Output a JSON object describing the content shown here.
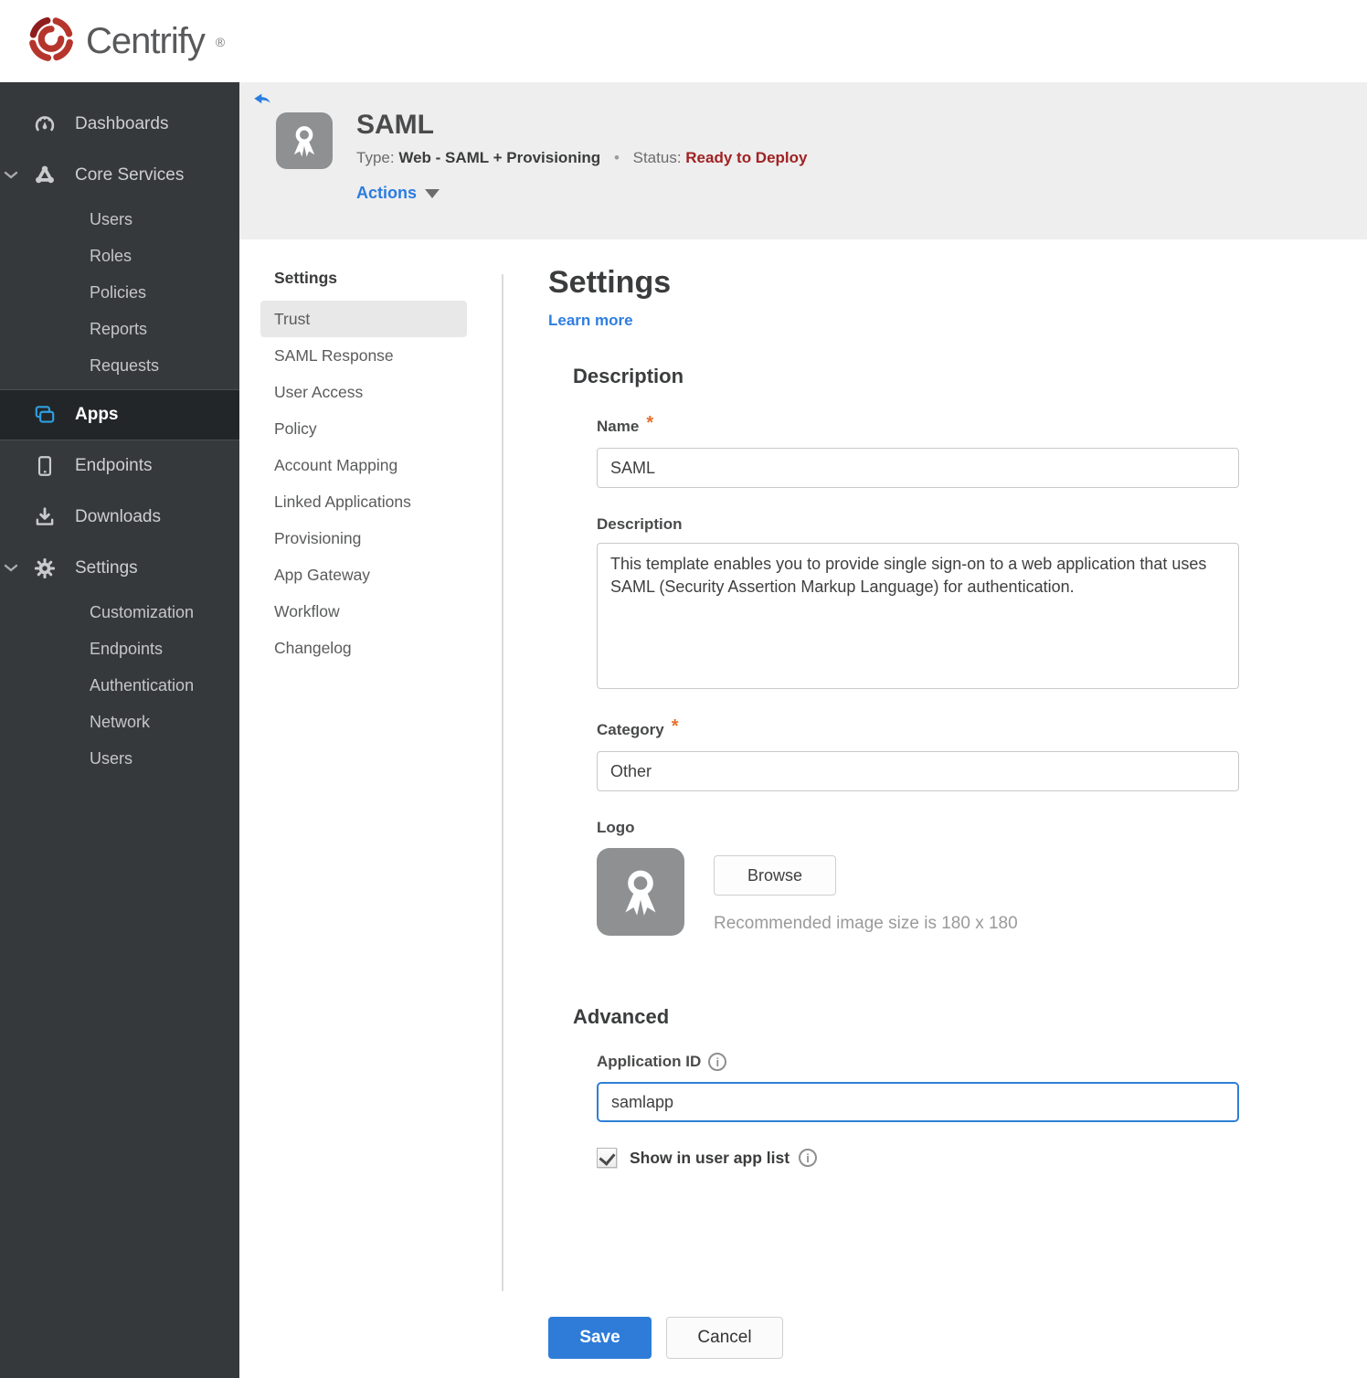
{
  "brand": {
    "name": "Centrify",
    "mark": "®"
  },
  "sidebar": {
    "dashboards": "Dashboards",
    "core_services": "Core Services",
    "core_children": [
      "Users",
      "Roles",
      "Policies",
      "Reports",
      "Requests"
    ],
    "apps": "Apps",
    "endpoints": "Endpoints",
    "downloads": "Downloads",
    "settings": "Settings",
    "settings_children": [
      "Customization",
      "Endpoints",
      "Authentication",
      "Network",
      "Users"
    ]
  },
  "header": {
    "title": "SAML",
    "type_label": "Type:",
    "type_value": "Web - SAML + Provisioning",
    "separator": "•",
    "status_label": "Status:",
    "status_value": "Ready to Deploy",
    "actions_label": "Actions"
  },
  "subnav": {
    "header": "Settings",
    "active": "Trust",
    "items": [
      "Trust",
      "SAML Response",
      "User Access",
      "Policy",
      "Account Mapping",
      "Linked Applications",
      "Provisioning",
      "App Gateway",
      "Workflow",
      "Changelog"
    ]
  },
  "main": {
    "title": "Settings",
    "learn_more": "Learn more",
    "description": {
      "heading": "Description",
      "name_label": "Name",
      "name_value": "SAML",
      "description_label": "Description",
      "description_value": "This template enables you to provide single sign-on to a web application that uses SAML (Security Assertion Markup Language) for authentication.",
      "category_label": "Category",
      "category_value": "Other",
      "logo_label": "Logo",
      "browse_label": "Browse",
      "logo_hint": "Recommended image size is 180 x 180"
    },
    "advanced": {
      "heading": "Advanced",
      "app_id_label": "Application ID",
      "app_id_value": "samlapp",
      "show_in_app_list_label": "Show in user app list",
      "checkbox_checked": "true"
    },
    "save_label": "Save",
    "cancel_label": "Cancel"
  },
  "colors": {
    "accent_blue": "#2e7cd8",
    "apps_icon_blue": "#2e9fe0",
    "status_red": "#a02223",
    "required_orange": "#e8702a",
    "sidebar_bg": "#36393c",
    "sidebar_active_bg": "#232629",
    "header_bg": "#eeeeee",
    "brand_red": "#b5352c"
  }
}
